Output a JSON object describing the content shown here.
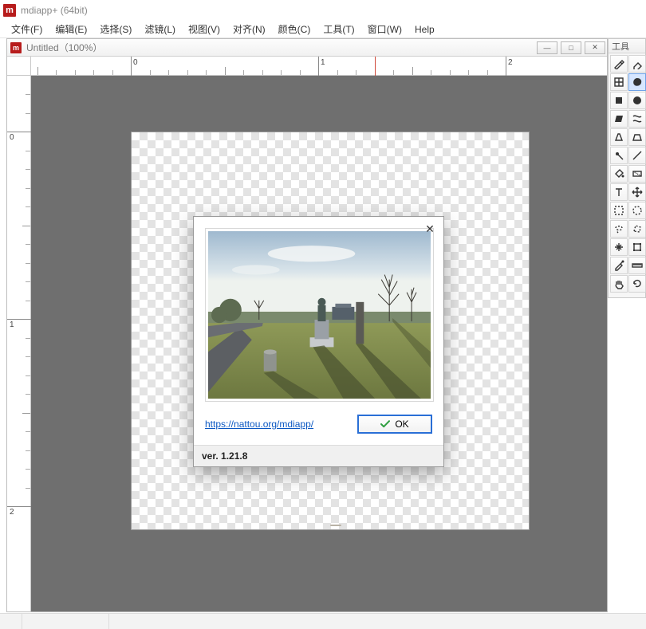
{
  "app": {
    "icon_letter": "m",
    "title": "mdiapp+  (64bit)"
  },
  "menu": {
    "items": [
      "文件(F)",
      "编辑(E)",
      "选择(S)",
      "滤镜(L)",
      "视图(V)",
      "对齐(N)",
      "颜色(C)",
      "工具(T)",
      "窗口(W)",
      "Help"
    ]
  },
  "document": {
    "title": "Untitled（100%）",
    "win_buttons": {
      "min": "—",
      "max": "□",
      "close": "✕"
    }
  },
  "rulers": {
    "h_major": [
      "0",
      "1",
      "2"
    ],
    "v_major": [
      "0",
      "1",
      "2"
    ]
  },
  "about": {
    "close_glyph": "✕",
    "link_text": "https://nattou.org/mdiapp/",
    "ok_label": "OK",
    "version_label": "ver. 1.21.8"
  },
  "toolpanel": {
    "title": "工具",
    "tools": [
      "pen-tool-icon",
      "eraser-icon",
      "grid-tool-icon",
      "blob-tool-icon",
      "quad-fill-icon",
      "ellipse-fill-icon",
      "skew-tool-icon",
      "warp-tool-icon",
      "perspective-tool-icon",
      "trapezoid-tool-icon",
      "pin-tool-icon",
      "line-tool-icon",
      "bucket-tool-icon",
      "gradient-tool-icon",
      "text-tool-icon",
      "move-tool-icon",
      "rect-select-icon",
      "ellipse-select-icon",
      "lasso-tool-icon",
      "polygon-select-icon",
      "sparkle-tool-icon",
      "transform-tool-icon",
      "eyedropper-icon",
      "ruler-tool-icon",
      "hand-tool-icon",
      "rotate-view-icon"
    ],
    "selected_index": 3
  }
}
